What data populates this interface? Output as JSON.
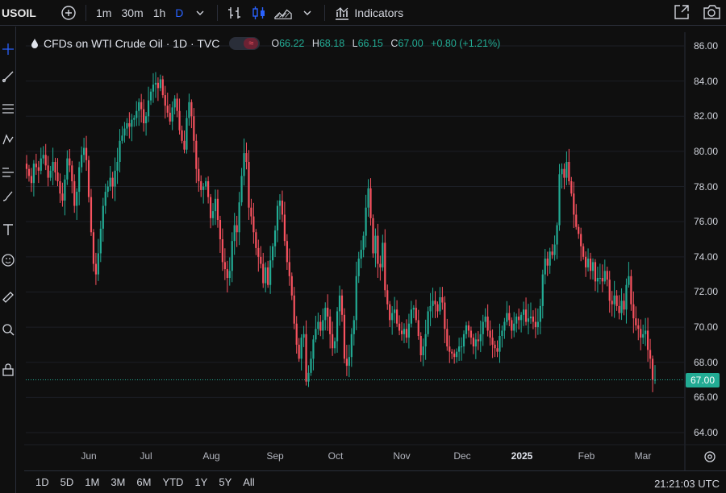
{
  "toolbar": {
    "symbol": "USOIL",
    "intervals": [
      "1m",
      "30m",
      "1h",
      "D"
    ],
    "active_interval": "D",
    "indicators_label": "Indicators",
    "icons": [
      "add-symbol-icon",
      "chevron-down-icon",
      "bar-style-icon",
      "candle-style-icon",
      "area-style-icon",
      "chevron-down-icon",
      "indicators-icon",
      "fullscreen-icon",
      "snapshot-icon"
    ]
  },
  "left_tools": [
    "crosshair-icon",
    "trendline-icon",
    "fib-icon",
    "pattern-icon",
    "prediction-icon",
    "brush-icon",
    "text-icon",
    "emoji-icon",
    "ruler-icon",
    "zoom-icon",
    "lock-icon"
  ],
  "legend": {
    "title": "CFDs on WTI Crude Oil · 1D · TVC",
    "open_label": "O",
    "open": "66.22",
    "high_label": "H",
    "high": "68.18",
    "low_label": "L",
    "low": "66.15",
    "close_label": "C",
    "close": "67.00",
    "change": "+0.80 (+1.21%)"
  },
  "price_axis": [
    "86.00",
    "84.00",
    "82.00",
    "80.00",
    "78.00",
    "76.00",
    "74.00",
    "72.00",
    "70.00",
    "68.00",
    "66.00",
    "64.00"
  ],
  "current_price": "67.00",
  "time_axis": [
    "Jun",
    "Jul",
    "Aug",
    "Sep",
    "Oct",
    "Nov",
    "Dec",
    "2025",
    "Feb",
    "Mar"
  ],
  "ranges": [
    "1D",
    "5D",
    "1M",
    "3M",
    "6M",
    "YTD",
    "1Y",
    "5Y",
    "All"
  ],
  "clock": "21:21:03 UTC",
  "colors": {
    "up": "#22ab94",
    "down": "#f7525f",
    "background": "#0f0f0f",
    "accent": "#2962ff"
  },
  "chart_data": {
    "type": "candlestick",
    "title": "CFDs on WTI Crude Oil · 1D · TVC",
    "ylim": [
      63.5,
      86.5
    ],
    "closes": [
      79.0,
      78.6,
      78.2,
      79.3,
      79.1,
      78.9,
      79.6,
      79.8,
      79.2,
      78.5,
      78.9,
      79.4,
      78.8,
      78.3,
      77.6,
      77.2,
      78.4,
      79.6,
      79.2,
      78.3,
      76.9,
      77.7,
      79.1,
      79.8,
      80.2,
      79.5,
      77.4,
      75.4,
      73.6,
      73.0,
      74.2,
      75.6,
      76.9,
      77.7,
      78.0,
      78.5,
      78.0,
      78.9,
      79.4,
      80.6,
      80.9,
      81.3,
      81.6,
      81.4,
      81.8,
      81.9,
      82.3,
      82.8,
      82.4,
      81.6,
      82.0,
      82.9,
      83.4,
      83.8,
      83.9,
      83.6,
      84.1,
      83.2,
      82.6,
      82.2,
      81.7,
      82.5,
      83.0,
      82.3,
      81.2,
      80.6,
      80.1,
      81.9,
      82.8,
      82.0,
      80.6,
      79.0,
      78.3,
      77.8,
      78.0,
      78.3,
      77.4,
      76.2,
      76.6,
      77.3,
      76.1,
      75.0,
      73.7,
      73.3,
      72.8,
      73.2,
      74.9,
      75.8,
      75.4,
      77.1,
      78.6,
      79.9,
      79.4,
      76.8,
      76.3,
      75.4,
      74.5,
      74.0,
      73.6,
      72.5,
      73.4,
      72.4,
      73.8,
      74.6,
      75.5,
      76.9,
      77.2,
      76.4,
      74.9,
      73.7,
      72.9,
      71.8,
      70.2,
      69.0,
      68.2,
      69.4,
      69.6,
      66.9,
      67.4,
      68.2,
      69.3,
      69.9,
      70.3,
      69.8,
      70.4,
      71.1,
      70.6,
      69.6,
      68.8,
      69.2,
      70.9,
      71.8,
      70.7,
      68.2,
      67.8,
      68.3,
      69.6,
      70.4,
      72.9,
      73.9,
      74.4,
      75.2,
      76.8,
      77.9,
      76.2,
      74.2,
      75.2,
      73.6,
      73.4,
      74.8,
      72.1,
      71.3,
      70.4,
      70.8,
      71.0,
      70.2,
      69.8,
      69.6,
      69.9,
      69.4,
      70.2,
      71.0,
      71.1,
      70.4,
      69.5,
      68.4,
      68.9,
      69.6,
      70.9,
      71.2,
      71.5,
      71.3,
      70.9,
      71.7,
      71.4,
      69.9,
      68.9,
      68.6,
      68.5,
      68.3,
      68.6,
      68.9,
      68.9,
      69.6,
      70.1,
      69.8,
      69.4,
      68.9,
      69.3,
      69.2,
      69.6,
      70.3,
      70.6,
      69.8,
      69.4,
      69.0,
      68.8,
      68.6,
      69.5,
      69.8,
      70.3,
      70.8,
      70.4,
      69.8,
      70.2,
      70.6,
      70.4,
      70.7,
      71.0,
      70.3,
      70.5,
      70.6,
      70.3,
      70.0,
      70.3,
      71.2,
      73.0,
      73.9,
      73.5,
      74.3,
      74.1,
      74.7,
      75.8,
      78.7,
      79.0,
      78.5,
      79.4,
      78.3,
      77.6,
      76.4,
      75.7,
      75.3,
      74.6,
      74.0,
      73.4,
      73.9,
      73.2,
      73.7,
      72.6,
      72.8,
      72.8,
      72.6,
      73.2,
      72.7,
      71.5,
      71.3,
      71.8,
      71.2,
      70.8,
      71.5,
      71.0,
      72.4,
      72.9,
      71.3,
      70.5,
      70.1,
      69.9,
      69.4,
      69.6,
      69.8,
      68.7,
      68.2,
      67.0,
      67.0
    ],
    "current": 67.0,
    "x_labels": [
      "Jun",
      "Jul",
      "Aug",
      "Sep",
      "Oct",
      "Nov",
      "Dec",
      "2025",
      "Feb",
      "Mar"
    ]
  }
}
